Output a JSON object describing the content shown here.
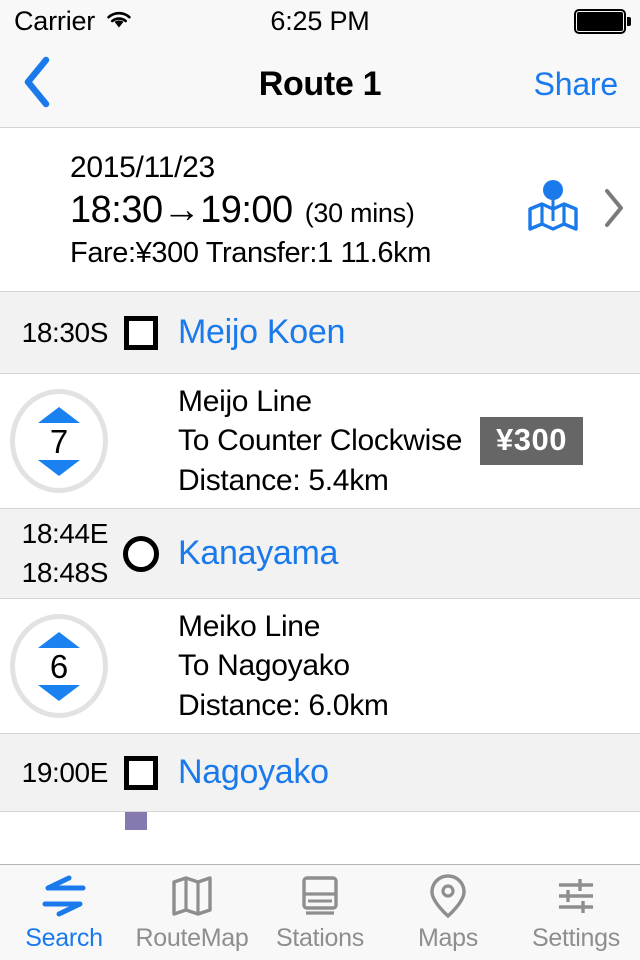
{
  "status_bar": {
    "carrier": "Carrier",
    "wifi_icon": "wifi-icon",
    "time": "6:25 PM",
    "battery_icon": "battery-full-icon"
  },
  "nav_bar": {
    "back_icon": "chevron-left-icon",
    "title": "Route 1",
    "share_label": "Share"
  },
  "summary": {
    "date": "2015/11/23",
    "time_range": "18:30→19:00",
    "duration": "(30 mins)",
    "details": "Fare:¥300 Transfer:1 11.6km",
    "map_icon": "map-pin-icon",
    "disclosure_icon": "chevron-right-icon"
  },
  "route": {
    "line_color": "#8679b0",
    "accent_color": "#1a7aeb",
    "fare_tag_color": "#666666",
    "stations": [
      {
        "time_primary": "18:30S",
        "time_secondary": "",
        "name": "Meijo Koen",
        "marker": "square-marker"
      },
      {
        "time_primary": "18:44E",
        "time_secondary": "18:48S",
        "name": "Kanayama",
        "marker": "circle-marker"
      },
      {
        "time_primary": "19:00E",
        "time_secondary": "",
        "name": "Nagoyako",
        "marker": "square-marker"
      }
    ],
    "legs": [
      {
        "stops": "7",
        "line_name": "Meijo Line",
        "direction": "To Counter Clockwise",
        "distance": "Distance: 5.4km",
        "fare": "¥300",
        "up_icon": "triangle-up-icon",
        "down_icon": "triangle-down-icon"
      },
      {
        "stops": "6",
        "line_name": "Meiko Line",
        "direction": "To Nagoyako",
        "distance": "Distance: 6.0km",
        "fare": "",
        "up_icon": "triangle-up-icon",
        "down_icon": "triangle-down-icon"
      }
    ],
    "span_arrow_icon": "double-arrow-vertical-icon"
  },
  "tab_bar": {
    "active_index": 0,
    "tabs": [
      {
        "label": "Search",
        "icon": "search-transfer-icon"
      },
      {
        "label": "RouteMap",
        "icon": "map-fold-icon"
      },
      {
        "label": "Stations",
        "icon": "train-icon"
      },
      {
        "label": "Maps",
        "icon": "location-pin-icon"
      },
      {
        "label": "Settings",
        "icon": "sliders-icon"
      }
    ]
  }
}
